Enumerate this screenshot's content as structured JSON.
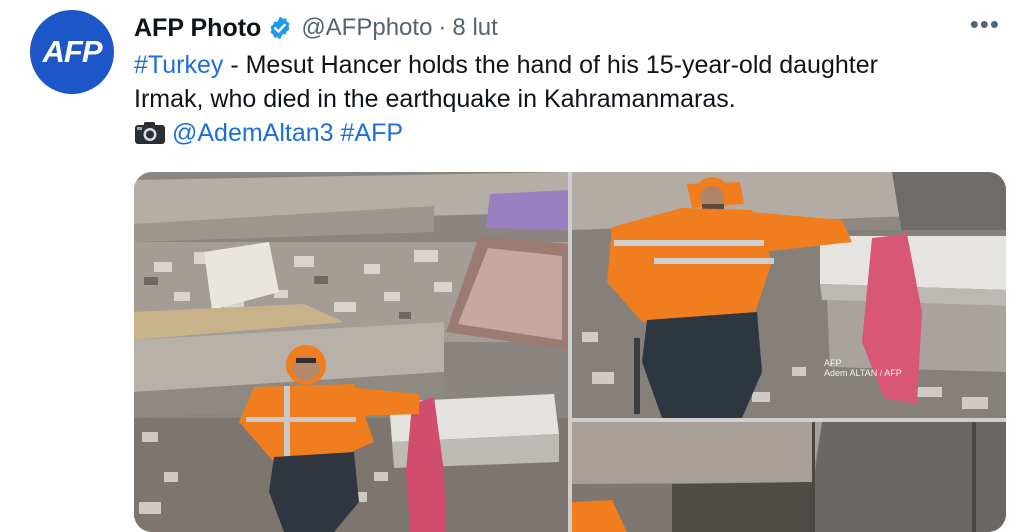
{
  "tweet": {
    "avatar_text": "AFP",
    "author_name": "AFP Photo",
    "verified_icon": "verified-badge-icon",
    "handle": "@AFPphoto",
    "separator": "·",
    "date": "8 lut",
    "more_icon": "more-options-icon",
    "more_glyph": "•••",
    "hashtag_turkey": "#Turkey",
    "text_line1": " - Mesut Hancer holds the hand of his 15-year-old daughter",
    "text_line2": "Irmak, who died in the earthquake in Kahramanmaras.",
    "camera_icon": "camera-icon",
    "mention": "@AdemAltan3",
    "hashtag_afp": "#AFP"
  },
  "media": {
    "photo2_watermark_line1": "AFP",
    "photo2_watermark_line2": "Adem ALTAN / AFP"
  },
  "colors": {
    "link": "#1d6fd6",
    "avatar_bg": "#1d56c6",
    "verified": "#1d9bf0",
    "secondary_text": "#536471",
    "jacket_orange": "#f07d1e"
  }
}
